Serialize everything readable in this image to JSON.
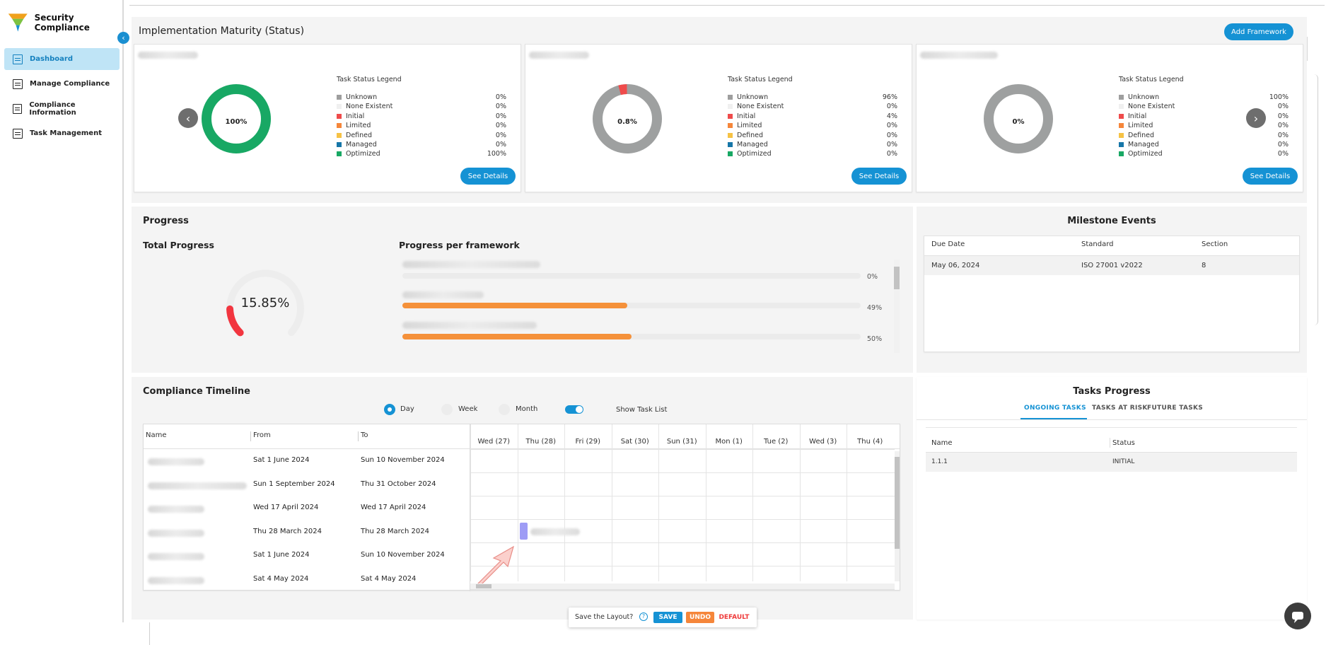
{
  "app": {
    "name": "Security Compliance"
  },
  "sidebar": {
    "items": [
      {
        "label": "Dashboard",
        "icon": "dashboard-icon",
        "active": true
      },
      {
        "label": "Manage Compliance",
        "icon": "manage-compliance-icon"
      },
      {
        "label": "Compliance Information",
        "icon": "compliance-info-icon"
      },
      {
        "label": "Task Management",
        "icon": "task-management-icon"
      }
    ]
  },
  "implementation": {
    "title": "Implementation Maturity (Status)",
    "add_button": "Add Framework",
    "legend_title": "Task Status Legend",
    "see_details": "See Details",
    "legend_labels": [
      "Unknown",
      "None Existent",
      "Initial",
      "Limited",
      "Defined",
      "Managed",
      "Optimized"
    ],
    "legend_colors": [
      "#9e9e9e",
      "#f0f0f0",
      "#ef4b4b",
      "#f5863a",
      "#f6c245",
      "#1676a8",
      "#18a864"
    ],
    "frameworks": [
      {
        "center": "100%",
        "values": [
          "0%",
          "0%",
          "0%",
          "0%",
          "0%",
          "0%",
          "100%"
        ]
      },
      {
        "center": "0.8%",
        "values": [
          "96%",
          "0%",
          "4%",
          "0%",
          "0%",
          "0%",
          "0%"
        ]
      },
      {
        "center": "0%",
        "values": [
          "100%",
          "0%",
          "0%",
          "0%",
          "0%",
          "0%",
          "0%"
        ]
      }
    ]
  },
  "progress": {
    "title": "Progress",
    "total_title": "Total Progress",
    "total_value": "15.85%",
    "total_fraction": 0.1585,
    "per_framework_title": "Progress per framework",
    "bars": [
      {
        "pct": "0%",
        "fraction": 0.0
      },
      {
        "pct": "49%",
        "fraction": 0.49
      },
      {
        "pct": "50%",
        "fraction": 0.5
      }
    ]
  },
  "milestones": {
    "title": "Milestone Events",
    "headers": [
      "Due Date",
      "Standard",
      "Section"
    ],
    "rows": [
      [
        "May 06, 2024",
        "ISO 27001 v2022",
        "8"
      ]
    ]
  },
  "timeline": {
    "title": "Compliance Timeline",
    "modes": [
      "Day",
      "Week",
      "Month"
    ],
    "active_mode": "Day",
    "show_task_list": "Show Task List",
    "headers": [
      "Name",
      "From",
      "To"
    ],
    "days": [
      "Wed (27)",
      "Thu (28)",
      "Fri (29)",
      "Sat (30)",
      "Sun (31)",
      "Mon (1)",
      "Tue (2)",
      "Wed (3)",
      "Thu (4)"
    ],
    "rows": [
      [
        "Sat 1 June 2024",
        "Sun 10 November 2024"
      ],
      [
        "Sun 1 September 2024",
        "Thu 31 October 2024"
      ],
      [
        "Wed 17 April 2024",
        "Wed 17 April 2024"
      ],
      [
        "Thu 28 March 2024",
        "Thu 28 March 2024"
      ],
      [
        "Sat 1 June 2024",
        "Sun 10 November 2024"
      ],
      [
        "Sat 4 May 2024",
        "Sat 4 May 2024"
      ]
    ]
  },
  "tasks": {
    "title": "Tasks Progress",
    "tabs": [
      "ONGOING TASKS",
      "TASKS AT RISK",
      "FUTURE TASKS"
    ],
    "headers": [
      "Name",
      "Status"
    ],
    "rows": [
      [
        "1.1.1",
        "INITIAL"
      ]
    ]
  },
  "savebar": {
    "question": "Save the Layout?",
    "save": "SAVE",
    "undo": "UNDO",
    "default": "DEFAULT"
  }
}
